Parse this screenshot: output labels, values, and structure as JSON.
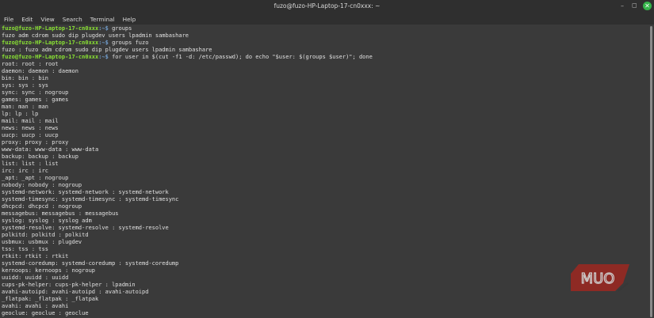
{
  "window": {
    "title": "fuzo@fuzo-HP-Laptop-17-cn0xxx: ~",
    "minimize_icon": "minimize-icon",
    "maximize_icon": "maximize-icon",
    "close_icon": "close-icon"
  },
  "menu": [
    "File",
    "Edit",
    "View",
    "Search",
    "Terminal",
    "Help"
  ],
  "prompt": {
    "user_host": "fuzo@fuzo-HP-Laptop-17-cn0xxx",
    "path": ":~$ "
  },
  "lines": [
    {
      "type": "cmd",
      "text": "groups"
    },
    {
      "type": "out",
      "text": "fuzo adm cdrom sudo dip plugdev users lpadmin sambashare"
    },
    {
      "type": "cmd",
      "text": "groups fuzo"
    },
    {
      "type": "out",
      "text": "fuzo : fuzo adm cdrom sudo dip plugdev users lpadmin sambashare"
    },
    {
      "type": "cmd",
      "text": "for user in $(cut -f1 -d: /etc/passwd); do echo \"$user: $(groups $user)\"; done"
    },
    {
      "type": "out",
      "text": "root: root : root"
    },
    {
      "type": "out",
      "text": "daemon: daemon : daemon"
    },
    {
      "type": "out",
      "text": "bin: bin : bin"
    },
    {
      "type": "out",
      "text": "sys: sys : sys"
    },
    {
      "type": "out",
      "text": "sync: sync : nogroup"
    },
    {
      "type": "out",
      "text": "games: games : games"
    },
    {
      "type": "out",
      "text": "man: man : man"
    },
    {
      "type": "out",
      "text": "lp: lp : lp"
    },
    {
      "type": "out",
      "text": "mail: mail : mail"
    },
    {
      "type": "out",
      "text": "news: news : news"
    },
    {
      "type": "out",
      "text": "uucp: uucp : uucp"
    },
    {
      "type": "out",
      "text": "proxy: proxy : proxy"
    },
    {
      "type": "out",
      "text": "www-data: www-data : www-data"
    },
    {
      "type": "out",
      "text": "backup: backup : backup"
    },
    {
      "type": "out",
      "text": "list: list : list"
    },
    {
      "type": "out",
      "text": "irc: irc : irc"
    },
    {
      "type": "out",
      "text": "_apt: _apt : nogroup"
    },
    {
      "type": "out",
      "text": "nobody: nobody : nogroup"
    },
    {
      "type": "out",
      "text": "systemd-network: systemd-network : systemd-network"
    },
    {
      "type": "out",
      "text": "systemd-timesync: systemd-timesync : systemd-timesync"
    },
    {
      "type": "out",
      "text": "dhcpcd: dhcpcd : nogroup"
    },
    {
      "type": "out",
      "text": "messagebus: messagebus : messagebus"
    },
    {
      "type": "out",
      "text": "syslog: syslog : syslog adm"
    },
    {
      "type": "out",
      "text": "systemd-resolve: systemd-resolve : systemd-resolve"
    },
    {
      "type": "out",
      "text": "polkitd: polkitd : polkitd"
    },
    {
      "type": "out",
      "text": "usbmux: usbmux : plugdev"
    },
    {
      "type": "out",
      "text": "tss: tss : tss"
    },
    {
      "type": "out",
      "text": "rtkit: rtkit : rtkit"
    },
    {
      "type": "out",
      "text": "systemd-coredump: systemd-coredump : systemd-coredump"
    },
    {
      "type": "out",
      "text": "kernoops: kernoops : nogroup"
    },
    {
      "type": "out",
      "text": "uuidd: uuidd : uuidd"
    },
    {
      "type": "out",
      "text": "cups-pk-helper: cups-pk-helper : lpadmin"
    },
    {
      "type": "out",
      "text": "avahi-autoipd: avahi-autoipd : avahi-autoipd"
    },
    {
      "type": "out",
      "text": "_flatpak: _flatpak : _flatpak"
    },
    {
      "type": "out",
      "text": "avahi: avahi : avahi"
    },
    {
      "type": "out",
      "text": "geoclue: geoclue : geoclue"
    }
  ],
  "watermark": {
    "text": "MUO",
    "color": "#8e2a24"
  },
  "colors": {
    "prompt_user": "#8ae234",
    "prompt_path": "#729fcf",
    "background": "#3a3a3a"
  }
}
